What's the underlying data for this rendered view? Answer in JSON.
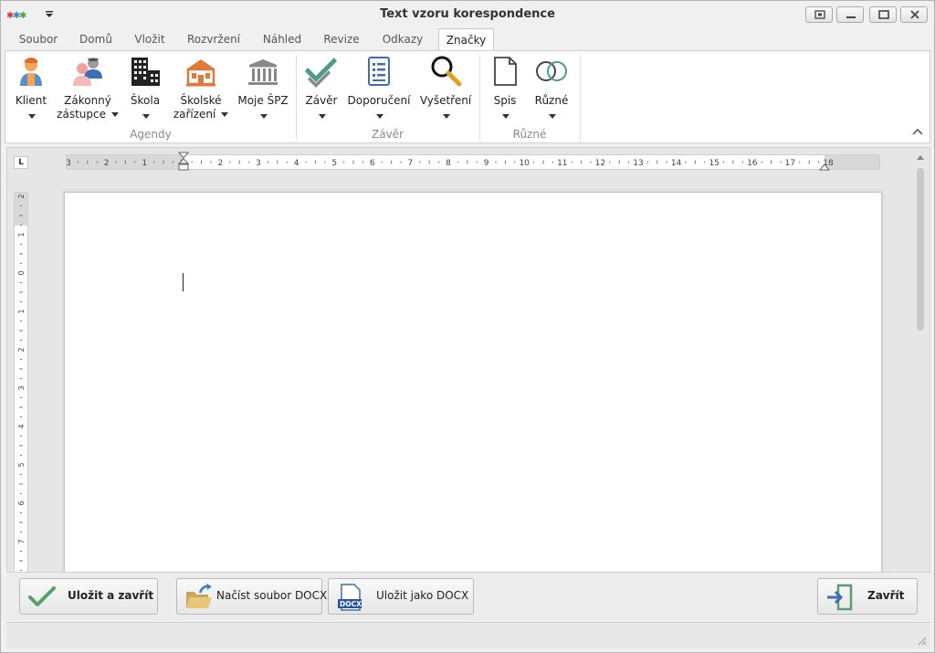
{
  "window": {
    "title": "Text vzoru korespondence"
  },
  "tabs": [
    {
      "label": "Soubor"
    },
    {
      "label": "Domů"
    },
    {
      "label": "Vložit"
    },
    {
      "label": "Rozvržení"
    },
    {
      "label": "Náhled"
    },
    {
      "label": "Revize"
    },
    {
      "label": "Odkazy"
    },
    {
      "label": "Značky",
      "active": true
    }
  ],
  "ribbon": {
    "groups": [
      {
        "label": "Agendy"
      },
      {
        "label": "Závěr"
      },
      {
        "label": "Různé"
      }
    ],
    "buttons": {
      "klient": {
        "line1": "Klient",
        "icon": "client-icon"
      },
      "zakonny": {
        "line1": "Zákonný",
        "line2": "zástupce",
        "icon": "legal-representative-icon"
      },
      "skola": {
        "line1": "Škola",
        "icon": "school-building-icon"
      },
      "skolske": {
        "line1": "Školské",
        "line2": "zařízení",
        "icon": "school-facility-icon"
      },
      "spz": {
        "line1": "Moje ŠPZ",
        "icon": "institution-icon"
      },
      "zaver": {
        "line1": "Závěr",
        "icon": "checkmark-icon"
      },
      "doporuceni": {
        "line1": "Doporučení",
        "icon": "document-list-icon"
      },
      "vysetreni": {
        "line1": "Vyšetření",
        "icon": "magnifier-icon"
      },
      "spis": {
        "line1": "Spis",
        "icon": "blank-page-icon"
      },
      "ruzne": {
        "line1": "Různé",
        "icon": "rings-icon"
      }
    }
  },
  "rulers": {
    "corner": "L",
    "horizontal_ticks": [
      "3",
      "2",
      "1",
      "1",
      "2",
      "3",
      "4",
      "5",
      "6",
      "7",
      "8",
      "9",
      "10",
      "11",
      "12",
      "13",
      "14",
      "15",
      "16",
      "17",
      "18"
    ],
    "vertical_ticks": [
      "2",
      "1",
      "0",
      "1",
      "2",
      "3",
      "4",
      "5",
      "6",
      "7"
    ]
  },
  "footer": {
    "save_close": "Uložit a zavřít",
    "load_docx": "Načíst soubor DOCX",
    "save_docx": "Uložit jako DOCX",
    "docx_badge": "DOCX",
    "close": "Zavřít"
  },
  "colors": {
    "accent": "#2b579a",
    "check_green": "#5a9e6f",
    "red": "#d9382c"
  }
}
